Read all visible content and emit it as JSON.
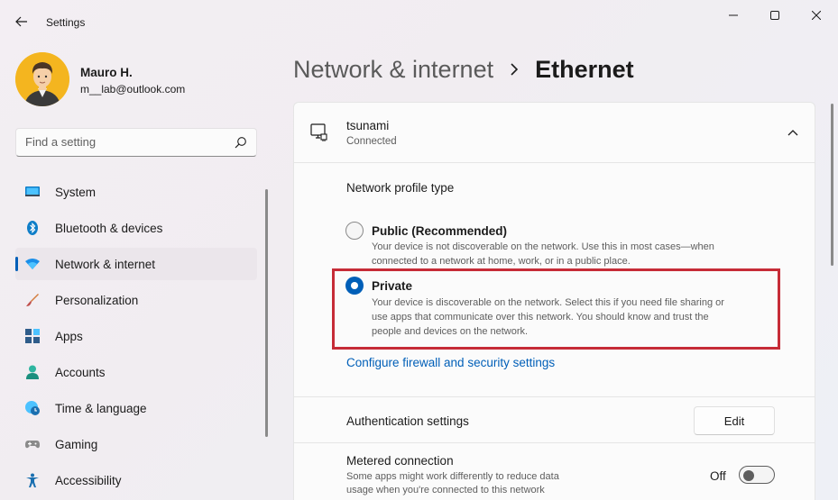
{
  "window": {
    "title": "Settings"
  },
  "user": {
    "name": "Mauro H.",
    "email": "m__lab@outlook.com"
  },
  "search": {
    "placeholder": "Find a setting"
  },
  "sidebar": {
    "items": [
      {
        "label": "System",
        "icon": "monitor-icon"
      },
      {
        "label": "Bluetooth & devices",
        "icon": "bluetooth-icon"
      },
      {
        "label": "Network & internet",
        "icon": "wifi-icon",
        "active": true
      },
      {
        "label": "Personalization",
        "icon": "brush-icon"
      },
      {
        "label": "Apps",
        "icon": "apps-icon"
      },
      {
        "label": "Accounts",
        "icon": "person-icon"
      },
      {
        "label": "Time & language",
        "icon": "globe-clock-icon"
      },
      {
        "label": "Gaming",
        "icon": "gamepad-icon"
      },
      {
        "label": "Accessibility",
        "icon": "accessibility-icon"
      }
    ]
  },
  "header": {
    "parent": "Network & internet",
    "current": "Ethernet"
  },
  "network": {
    "name": "tsunami",
    "status": "Connected"
  },
  "profile": {
    "title": "Network profile type",
    "options": [
      {
        "title": "Public (Recommended)",
        "desc_line1": "Your device is not discoverable on the network. Use this in most cases—when",
        "desc_line2": "connected to a network at home, work, or in a public place.",
        "selected": false
      },
      {
        "title": "Private",
        "desc_line1": "Your device is discoverable on the network. Select this if you need file sharing or",
        "desc_line2": "use apps that communicate over this network. You should know and trust the",
        "desc_line3": "people and devices on the network.",
        "selected": true
      }
    ],
    "firewall_link": "Configure firewall and security settings"
  },
  "auth": {
    "label": "Authentication settings",
    "button": "Edit"
  },
  "metered": {
    "label": "Metered connection",
    "desc_line1": "Some apps might work differently to reduce data",
    "desc_line2": "usage when you're connected to this network",
    "state": "Off",
    "on": false
  },
  "colors": {
    "accent": "#005fb8",
    "highlight": "#c62c37"
  }
}
